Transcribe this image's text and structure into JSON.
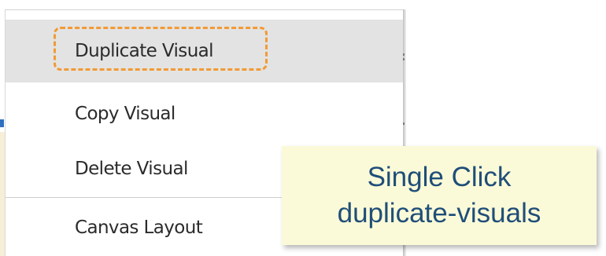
{
  "context_menu": {
    "items": [
      {
        "label": "Duplicate Visual",
        "highlighted": true
      },
      {
        "label": "Copy Visual",
        "highlighted": false
      },
      {
        "label": "Delete Visual",
        "highlighted": false
      },
      {
        "label": "Canvas Layout",
        "highlighted": false
      }
    ],
    "hover_color": "#e3e3e3",
    "focus_outline_color": "#f29a34"
  },
  "callout": {
    "line1": "Single Click",
    "line2": "duplicate-visuals",
    "background_color": "#fbfad8",
    "text_color": "#1f4e79"
  }
}
